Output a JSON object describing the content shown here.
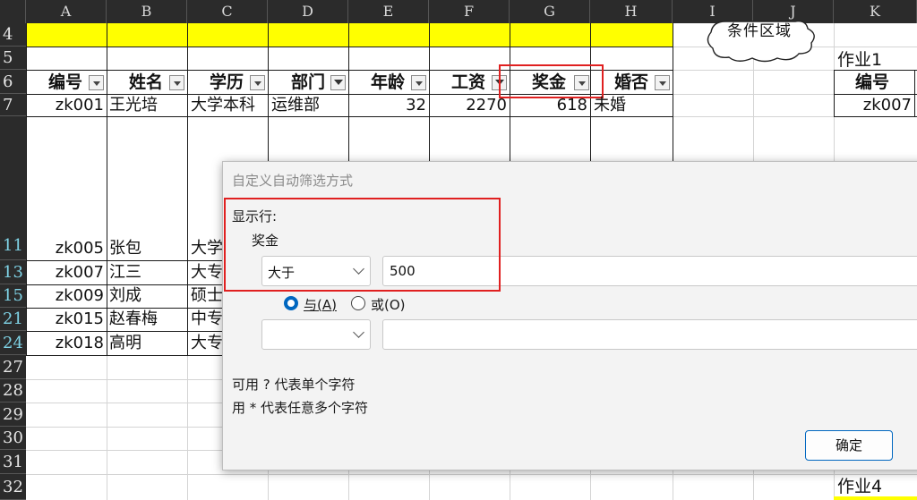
{
  "columns": [
    "A",
    "B",
    "C",
    "D",
    "E",
    "F",
    "G",
    "H",
    "I",
    "J",
    "K"
  ],
  "rows": [
    "4",
    "5",
    "6",
    "7",
    "11",
    "13",
    "15",
    "21",
    "24",
    "27",
    "28",
    "29",
    "30",
    "31",
    "32"
  ],
  "headers": [
    "编号",
    "姓名",
    "学历",
    "部门",
    "年龄",
    "工资",
    "奖金",
    "婚否"
  ],
  "row7": [
    "zk001",
    "王光培",
    "大学本科",
    "运维部",
    "32",
    "2270",
    "618",
    "未婚"
  ],
  "visible_rows": [
    {
      "id": "zk005",
      "name": "张包",
      "edu": "大学"
    },
    {
      "id": "zk007",
      "name": "江三",
      "edu": "大专"
    },
    {
      "id": "zk009",
      "name": "刘成",
      "edu": "硕士"
    },
    {
      "id": "zk015",
      "name": "赵春梅",
      "edu": "中专"
    },
    {
      "id": "zk018",
      "name": "高明",
      "edu": "大专"
    }
  ],
  "side": {
    "cloud_text": "条件区域",
    "task1": "作业1",
    "task1_header": "编号",
    "task1_value": "zk007",
    "task4": "作业4"
  },
  "dialog": {
    "title": "自定义自动筛选方式",
    "show_rows": "显示行:",
    "field": "奖金",
    "operator1": "大于",
    "value1": "500",
    "and_label": "与(A)",
    "or_label": "或(O)",
    "operator2": "",
    "value2": "",
    "hint1": "可用 ? 代表单个字符",
    "hint2": "用 * 代表任意多个字符",
    "ok": "确定"
  },
  "colors": {
    "yellow": "#ffff00",
    "highlight_red": "#e02020",
    "accent_blue": "#0067c0",
    "header_dark": "#2b2b2b"
  }
}
